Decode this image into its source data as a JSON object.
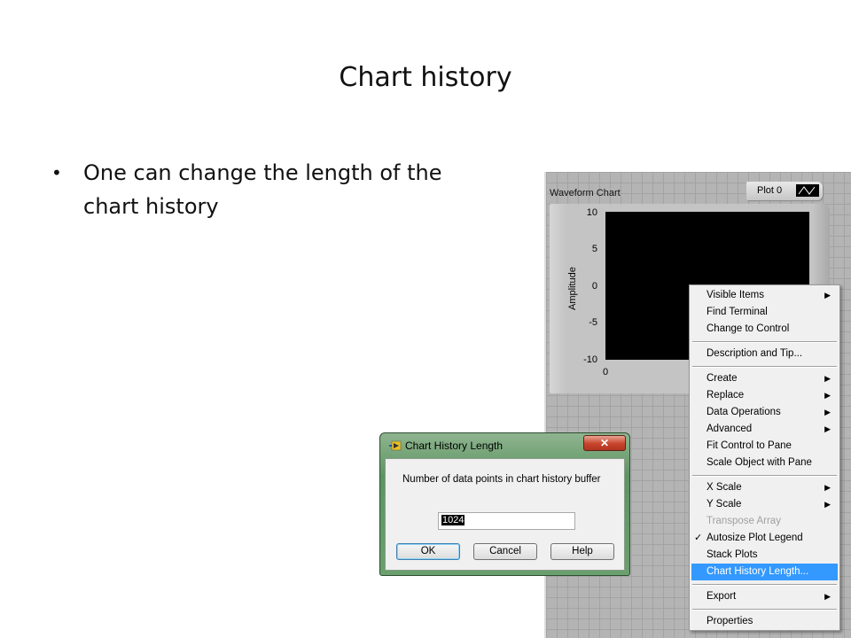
{
  "slide": {
    "title": "Chart history",
    "bullets": [
      "One can change the length of the chart history"
    ]
  },
  "chart_panel": {
    "label": "Waveform Chart",
    "legend": {
      "plot_name": "Plot 0",
      "swatch_icon": "line-plot-icon"
    },
    "y_axis_title": "Amplitude",
    "y_ticks": [
      "10",
      "5",
      "0",
      "-5",
      "-10"
    ],
    "x_ticks": [
      "0"
    ]
  },
  "context_menu": {
    "items": [
      {
        "label": "Visible Items",
        "submenu": true
      },
      {
        "label": "Find Terminal"
      },
      {
        "label": "Change to Control"
      },
      {
        "separator": true
      },
      {
        "label": "Description and Tip..."
      },
      {
        "separator": true
      },
      {
        "label": "Create",
        "submenu": true
      },
      {
        "label": "Replace",
        "submenu": true
      },
      {
        "label": "Data Operations",
        "submenu": true
      },
      {
        "label": "Advanced",
        "submenu": true
      },
      {
        "label": "Fit Control to Pane"
      },
      {
        "label": "Scale Object with Pane"
      },
      {
        "separator": true
      },
      {
        "label": "X Scale",
        "submenu": true
      },
      {
        "label": "Y Scale",
        "submenu": true
      },
      {
        "label": "Transpose Array",
        "disabled": true
      },
      {
        "label": "Autosize Plot Legend",
        "checked": true
      },
      {
        "label": "Stack Plots"
      },
      {
        "label": "Chart History Length...",
        "selected": true
      },
      {
        "separator": true
      },
      {
        "label": "Export",
        "submenu": true
      },
      {
        "separator": true
      },
      {
        "label": "Properties"
      }
    ],
    "submenu_glyph": "▶",
    "check_glyph": "✓"
  },
  "dialog": {
    "title": "Chart History Length",
    "close_label": "✕",
    "prompt": "Number of data points in chart history buffer",
    "input_value": "1024",
    "buttons": {
      "ok": "OK",
      "cancel": "Cancel",
      "help": "Help"
    }
  },
  "colors": {
    "menu_highlight": "#3399ff",
    "dialog_frame": "#5d9562",
    "close_button": "#c8442c"
  }
}
